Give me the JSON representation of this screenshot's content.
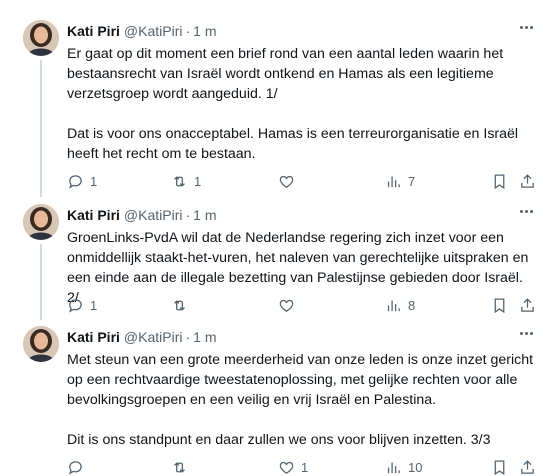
{
  "tweets": [
    {
      "author_name": "Kati Piri",
      "author_handle": "@KatiPiri",
      "separator": "·",
      "time": "1 m",
      "text": "Er gaat op dit moment een brief rond van een aantal leden waarin het\nbestaansrecht van Israël wordt ontkend en Hamas als een legitieme\nverzetsgroep wordt aangeduid. 1/\n\nDat is voor ons onacceptabel. Hamas is een terreurorganisatie en Israël\nheeft het recht om te bestaan.",
      "replies": "1",
      "retweets": "1",
      "likes": "",
      "views": "7"
    },
    {
      "author_name": "Kati Piri",
      "author_handle": "@KatiPiri",
      "separator": "·",
      "time": "1 m",
      "text": "GroenLinks-PvdA wil dat de Nederlandse regering zich inzet voor een\nonmiddellijk staakt-het-vuren, het naleven van gerechtelijke uitspraken en\neen einde aan de illegale bezetting van Palestijnse gebieden door Israël. 2/",
      "replies": "1",
      "retweets": "",
      "likes": "",
      "views": "8"
    },
    {
      "author_name": "Kati Piri",
      "author_handle": "@KatiPiri",
      "separator": "·",
      "time": "1 m",
      "text": "Met steun van een grote meerderheid van onze leden is onze inzet gericht\nop een rechtvaardige tweestatenoplossing, met gelijke rechten voor alle\nbevolkingsgroepen en een veilig en vrij Israël en Palestina.\n\nDit is ons standpunt en daar zullen we ons voor blijven inzetten. 3/3",
      "replies": "",
      "retweets": "",
      "likes": "1",
      "views": "10"
    }
  ],
  "icons": {
    "reply": "reply-icon",
    "retweet": "retweet-icon",
    "like": "heart-icon",
    "views": "views-icon",
    "bookmark": "bookmark-icon",
    "share": "share-icon",
    "more": "more-icon"
  },
  "colors": {
    "text": "#0f1419",
    "secondary": "#536471",
    "thread_line": "#cfd9de"
  }
}
